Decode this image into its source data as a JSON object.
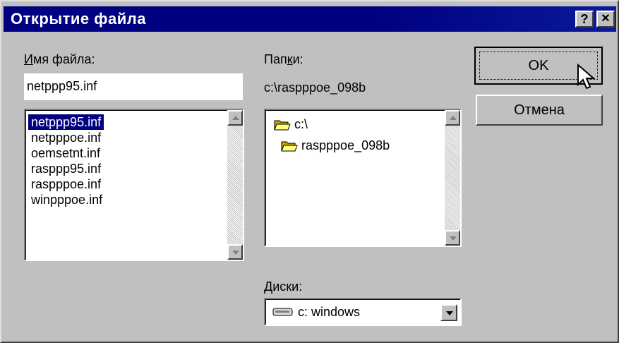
{
  "window": {
    "title": "Открытие файла",
    "help_button": "?",
    "close_button": "✕"
  },
  "filename": {
    "label_underlined": "И",
    "label_rest": "мя файла:",
    "value": "netppp95.inf"
  },
  "files": [
    {
      "name": "netppp95.inf",
      "selected": true
    },
    {
      "name": "netpppoe.inf",
      "selected": false
    },
    {
      "name": "oemsetnt.inf",
      "selected": false
    },
    {
      "name": "rasppp95.inf",
      "selected": false
    },
    {
      "name": "raspppoe.inf",
      "selected": false
    },
    {
      "name": "winpppoe.inf",
      "selected": false
    }
  ],
  "folders": {
    "label_pre": "Пап",
    "label_underlined": "к",
    "label_post": "и:",
    "current_path": "c:\\raspppoe_098b",
    "tree": [
      {
        "name": "c:\\",
        "icon": "open-folder-icon"
      },
      {
        "name": "raspppoe_098b",
        "icon": "open-folder-icon"
      }
    ]
  },
  "drives": {
    "label_underlined": "Д",
    "label_rest": "иски:",
    "value": "c: windows",
    "icon": "drive-icon"
  },
  "buttons": {
    "ok": "OK",
    "cancel": "Отмена"
  }
}
